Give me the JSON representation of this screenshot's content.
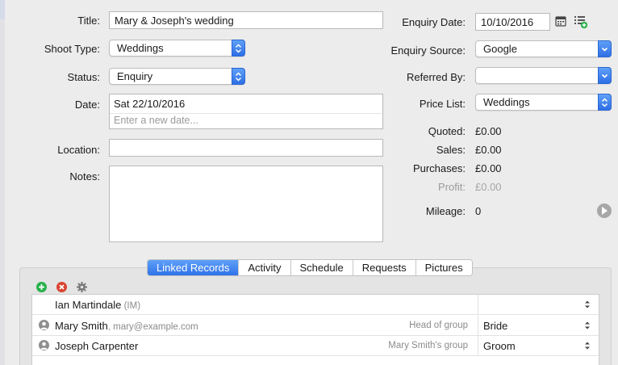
{
  "form": {
    "title_label": "Title:",
    "title_value": "Mary & Joseph's wedding",
    "shoot_type_label": "Shoot Type:",
    "shoot_type_value": "Weddings",
    "status_label": "Status:",
    "status_value": "Enquiry",
    "date_label": "Date:",
    "date_value": "Sat 22/10/2016",
    "date_placeholder": "Enter a new date...",
    "location_label": "Location:",
    "location_value": "",
    "notes_label": "Notes:",
    "notes_value": ""
  },
  "right": {
    "enquiry_date_label": "Enquiry Date:",
    "enquiry_date_value": "10/10/2016",
    "enquiry_source_label": "Enquiry Source:",
    "enquiry_source_value": "Google",
    "referred_by_label": "Referred By:",
    "referred_by_value": "",
    "price_list_label": "Price List:",
    "price_list_value": "Weddings",
    "quoted_label": "Quoted:",
    "quoted_value": "£0.00",
    "sales_label": "Sales:",
    "sales_value": "£0.00",
    "purchases_label": "Purchases:",
    "purchases_value": "£0.00",
    "profit_label": "Profit:",
    "profit_value": "£0.00",
    "mileage_label": "Mileage:",
    "mileage_value": "0"
  },
  "tabs": [
    "Linked Records",
    "Activity",
    "Schedule",
    "Requests",
    "Pictures"
  ],
  "records": [
    {
      "name": "Ian Martindale",
      "sub": " (IM)",
      "group": "",
      "role": ""
    },
    {
      "name": "Mary Smith",
      "sub": ", mary@example.com",
      "group": "Head of group",
      "role": "Bride"
    },
    {
      "name": "Joseph Carpenter",
      "sub": "",
      "group": "Mary Smith's group",
      "role": "Groom"
    }
  ],
  "icons": {
    "add": "add-icon",
    "remove": "remove-icon",
    "settings": "gear-icon",
    "calendar": "calendar-icon",
    "list_add": "list-add-icon",
    "person": "person-icon",
    "play": "play-icon"
  },
  "colors": {
    "accent": "#2f72ea",
    "add": "#27b04a",
    "remove": "#d9432f"
  }
}
